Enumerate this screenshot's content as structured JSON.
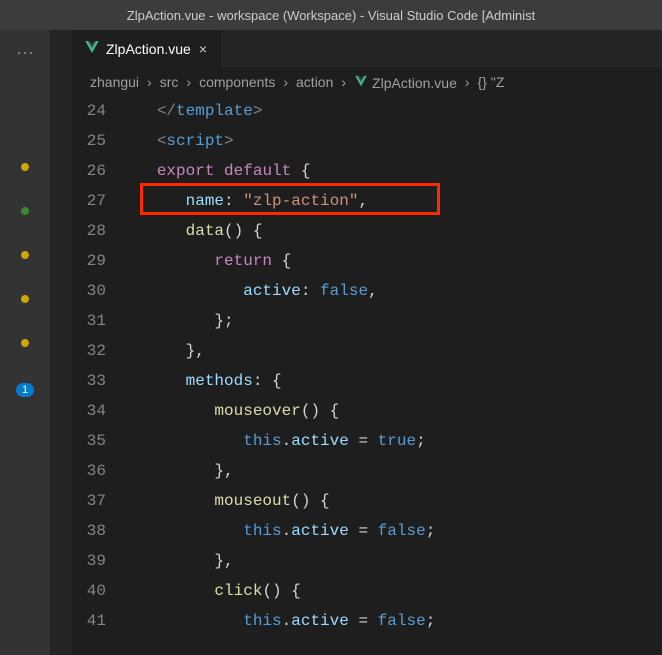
{
  "titlebar": "ZlpAction.vue - workspace (Workspace) - Visual Studio Code [Administ",
  "activity": {
    "dots_status": [
      "yellow",
      "green",
      "yellow",
      "yellow",
      "yellow"
    ],
    "badge": "1"
  },
  "tab": {
    "label": "ZlpAction.vue",
    "close": "×"
  },
  "breadcrumbs": [
    {
      "text": "zhangui"
    },
    {
      "text": "src"
    },
    {
      "text": "components"
    },
    {
      "text": "action"
    },
    {
      "text": "ZlpAction.vue",
      "icon": "vue-icon"
    },
    {
      "text": "\"Z",
      "icon": "brace-icon"
    }
  ],
  "bc_sep": "›",
  "editor": {
    "startLine": 24,
    "highlightLine": 27,
    "lines": [
      [
        {
          "indent": 1
        },
        {
          "cls": "t-tag",
          "t": "</"
        },
        {
          "cls": "t-tagname",
          "t": "template"
        },
        {
          "cls": "t-tag",
          "t": ">"
        }
      ],
      [
        {
          "indent": 1
        },
        {
          "cls": "t-tag",
          "t": "<"
        },
        {
          "cls": "t-tagname",
          "t": "script"
        },
        {
          "cls": "t-tag",
          "t": ">"
        }
      ],
      [
        {
          "indent": 1
        },
        {
          "cls": "t-keyword",
          "t": "export"
        },
        {
          "t": " "
        },
        {
          "cls": "t-keyword",
          "t": "default"
        },
        {
          "t": " "
        },
        {
          "cls": "t-punc",
          "t": "{"
        }
      ],
      [
        {
          "indent": 2
        },
        {
          "cls": "t-prop",
          "t": "name"
        },
        {
          "cls": "t-punc",
          "t": ":"
        },
        {
          "t": " "
        },
        {
          "cls": "t-string",
          "t": "\"zlp-action\""
        },
        {
          "cls": "t-punc",
          "t": ","
        }
      ],
      [
        {
          "indent": 2
        },
        {
          "cls": "t-func",
          "t": "data"
        },
        {
          "cls": "t-punc",
          "t": "()"
        },
        {
          "t": " "
        },
        {
          "cls": "t-punc",
          "t": "{"
        }
      ],
      [
        {
          "indent": 3
        },
        {
          "cls": "t-keyword",
          "t": "return"
        },
        {
          "t": " "
        },
        {
          "cls": "t-punc",
          "t": "{"
        }
      ],
      [
        {
          "indent": 4
        },
        {
          "cls": "t-prop",
          "t": "active"
        },
        {
          "cls": "t-punc",
          "t": ":"
        },
        {
          "t": " "
        },
        {
          "cls": "t-bool",
          "t": "false"
        },
        {
          "cls": "t-punc",
          "t": ","
        }
      ],
      [
        {
          "indent": 3
        },
        {
          "cls": "t-punc",
          "t": "};"
        }
      ],
      [
        {
          "indent": 2
        },
        {
          "cls": "t-punc",
          "t": "},"
        }
      ],
      [
        {
          "indent": 2
        },
        {
          "cls": "t-prop",
          "t": "methods"
        },
        {
          "cls": "t-punc",
          "t": ":"
        },
        {
          "t": " "
        },
        {
          "cls": "t-punc",
          "t": "{"
        }
      ],
      [
        {
          "indent": 3
        },
        {
          "cls": "t-func",
          "t": "mouseover"
        },
        {
          "cls": "t-punc",
          "t": "()"
        },
        {
          "t": " "
        },
        {
          "cls": "t-punc",
          "t": "{"
        }
      ],
      [
        {
          "indent": 4
        },
        {
          "cls": "t-var",
          "t": "this"
        },
        {
          "cls": "t-punc",
          "t": "."
        },
        {
          "cls": "t-prop",
          "t": "active"
        },
        {
          "t": " "
        },
        {
          "cls": "t-op",
          "t": "="
        },
        {
          "t": " "
        },
        {
          "cls": "t-bool",
          "t": "true"
        },
        {
          "cls": "t-punc",
          "t": ";"
        }
      ],
      [
        {
          "indent": 3
        },
        {
          "cls": "t-punc",
          "t": "},"
        }
      ],
      [
        {
          "indent": 3
        },
        {
          "cls": "t-func",
          "t": "mouseout"
        },
        {
          "cls": "t-punc",
          "t": "()"
        },
        {
          "t": " "
        },
        {
          "cls": "t-punc",
          "t": "{"
        }
      ],
      [
        {
          "indent": 4
        },
        {
          "cls": "t-var",
          "t": "this"
        },
        {
          "cls": "t-punc",
          "t": "."
        },
        {
          "cls": "t-prop",
          "t": "active"
        },
        {
          "t": " "
        },
        {
          "cls": "t-op",
          "t": "="
        },
        {
          "t": " "
        },
        {
          "cls": "t-bool",
          "t": "false"
        },
        {
          "cls": "t-punc",
          "t": ";"
        }
      ],
      [
        {
          "indent": 3
        },
        {
          "cls": "t-punc",
          "t": "},"
        }
      ],
      [
        {
          "indent": 3
        },
        {
          "cls": "t-func",
          "t": "click"
        },
        {
          "cls": "t-punc",
          "t": "()"
        },
        {
          "t": " "
        },
        {
          "cls": "t-punc",
          "t": "{"
        }
      ],
      [
        {
          "indent": 4
        },
        {
          "cls": "t-var",
          "t": "this"
        },
        {
          "cls": "t-punc",
          "t": "."
        },
        {
          "cls": "t-prop",
          "t": "active"
        },
        {
          "t": " "
        },
        {
          "cls": "t-op",
          "t": "="
        },
        {
          "t": " "
        },
        {
          "cls": "t-bool",
          "t": "false"
        },
        {
          "cls": "t-punc",
          "t": ";"
        }
      ]
    ]
  }
}
